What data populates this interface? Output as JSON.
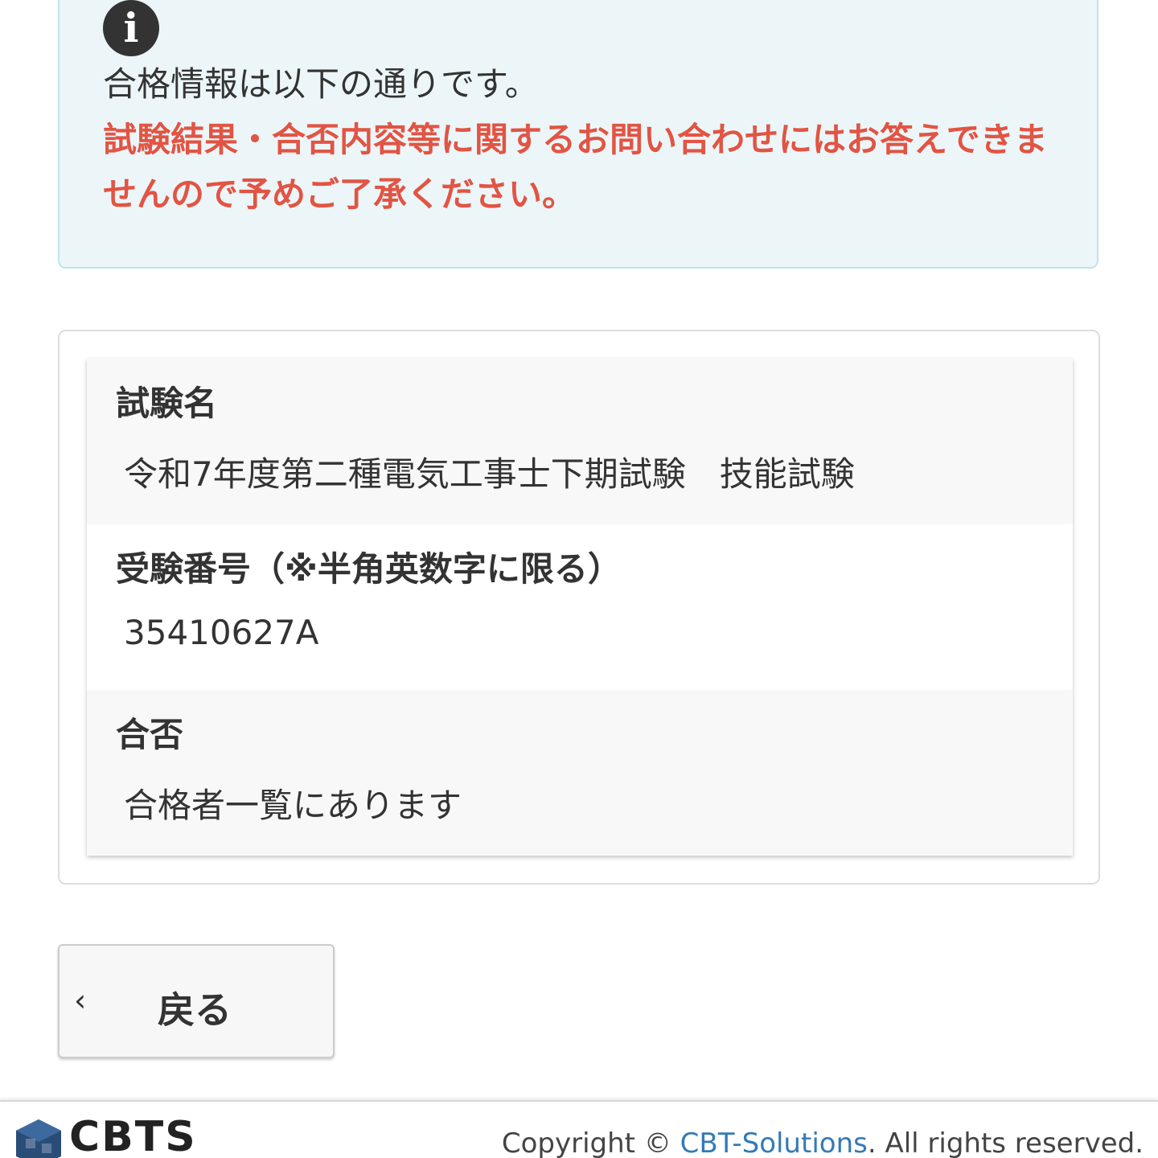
{
  "alert": {
    "icon": "info-icon",
    "icon_glyph": "i",
    "message": "合格情報は以下の通りです。",
    "warning": "試験結果・合否内容等に関するお問い合わせにはお答えできませんので予めご了承ください。",
    "background_color": "#ecf6f9",
    "warning_color": "#e25443"
  },
  "result": {
    "items": [
      {
        "label": "試験名",
        "value": "令和7年度第二種電気工事士下期試験　技能試験"
      },
      {
        "label": "受験番号（※半角英数字に限る）",
        "value": "35410627A"
      },
      {
        "label": "合否",
        "value": "合格者一覧にあります"
      }
    ]
  },
  "back_button": {
    "icon": "chevron-left-icon",
    "icon_glyph": "‹",
    "label": "戻る"
  },
  "footer": {
    "logo_text": "CBTS",
    "copyright_prefix": "Copyright © ",
    "copyright_link": "CBT-Solutions",
    "copyright_suffix": ". All rights reserved.",
    "link_color": "#337ab7"
  }
}
